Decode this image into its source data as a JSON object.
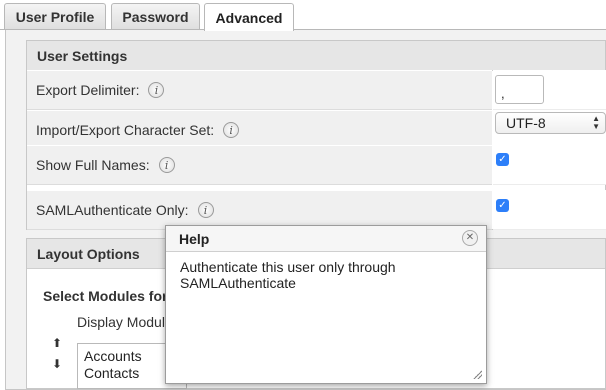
{
  "tabs": [
    {
      "label": "User Profile"
    },
    {
      "label": "Password"
    },
    {
      "label": "Advanced"
    }
  ],
  "user_settings": {
    "title": "User Settings",
    "rows": [
      {
        "label": "Export Delimiter:",
        "value": ","
      },
      {
        "label": "Import/Export Character Set:",
        "value": "UTF-8"
      },
      {
        "label": "Show Full Names:",
        "checked": true
      },
      {
        "label": "SAMLAuthenticate Only:",
        "checked": true
      }
    ]
  },
  "layout_options": {
    "title": "Layout Options",
    "select_modules_label": "Select Modules for",
    "display_modules_label": "Display Module",
    "modules": [
      "Accounts",
      "Contacts"
    ]
  },
  "help_popup": {
    "title": "Help",
    "body": "Authenticate this user only through SAMLAuthenticate"
  },
  "icons": {
    "info": "info-icon",
    "close": "close-icon",
    "resize": "resize-grip-icon",
    "move_up": "arrow-up-icon",
    "move_down": "arrow-down-icon"
  },
  "colors": {
    "checkbox": "#2d7ff9",
    "section_header": "#e6e6e6"
  }
}
